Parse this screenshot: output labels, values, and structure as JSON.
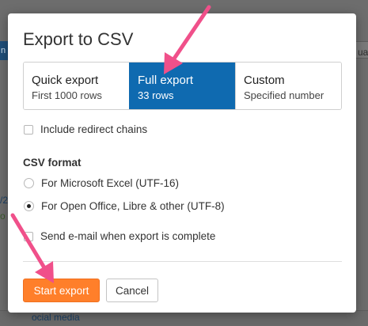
{
  "background": {
    "left_tab_fragment": "n",
    "fragments": [
      {
        "text": "/2",
        "style": "blue"
      },
      {
        "text": "o",
        "style": "green"
      },
      {
        "text": "ua",
        "style": "dark"
      },
      {
        "text": "ocial media",
        "style": "blue"
      }
    ]
  },
  "dialog": {
    "title": "Export to CSV",
    "export_options": [
      {
        "label": "Quick export",
        "sub": "First 1000 rows",
        "selected": false
      },
      {
        "label": "Full export",
        "sub": "33 rows",
        "selected": true
      },
      {
        "label": "Custom",
        "sub": "Specified number",
        "selected": false
      }
    ],
    "include_redirect_label": "Include redirect chains",
    "include_redirect_checked": false,
    "csv_format_heading": "CSV format",
    "format_options": [
      {
        "label": "For Microsoft Excel (UTF-16)",
        "selected": false
      },
      {
        "label": "For Open Office, Libre & other (UTF-8)",
        "selected": true
      }
    ],
    "email_label": "Send e-mail when export is complete",
    "email_checked": false,
    "start_button": "Start export",
    "cancel_button": "Cancel"
  },
  "colors": {
    "accent_blue": "#0f6ab0",
    "primary_orange": "#ff7f2a",
    "annotation_arrow": "#f0508a"
  },
  "icons": {
    "annotation_arrows": [
      "arrow-to-full-export",
      "arrow-to-start-export"
    ]
  }
}
